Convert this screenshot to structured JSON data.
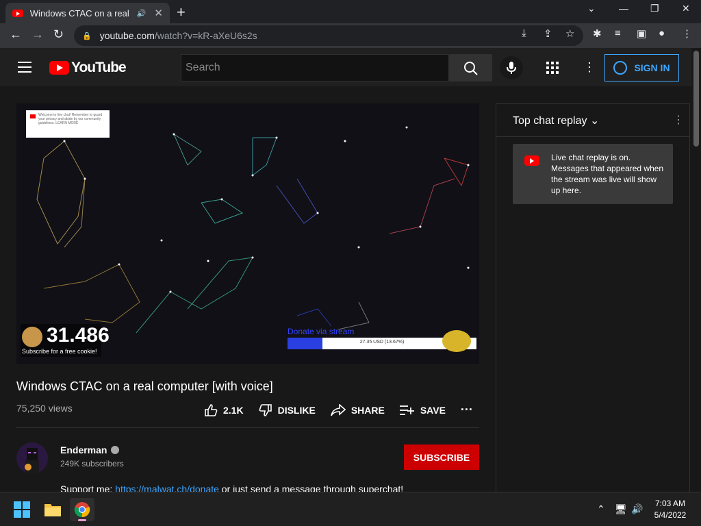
{
  "browser": {
    "tab_title": "Windows CTAC on a real computer [with voice]",
    "url_host": "youtube.com",
    "url_path": "/watch?v=kR-aXeU6s2s"
  },
  "header": {
    "logo_text": "YouTube",
    "search_placeholder": "Search",
    "signin_label": "SIGN IN"
  },
  "video": {
    "overlay_notice": "Welcome to live chat! Remember to guard your privacy and abide by our community guidelines. LEARN MORE",
    "cookie_count": "31.486",
    "cookie_sub": "Subscribe for a free cookie!",
    "donate_label": "Donate via stream",
    "progress_label": "27.35 USD (13.67%)",
    "progress_fraction": 0.1367,
    "title": "Windows CTAC on a real computer [with voice]",
    "views": "75,250 views",
    "like_count": "2.1K",
    "dislike_label": "DISLIKE",
    "share_label": "SHARE",
    "save_label": "SAVE"
  },
  "channel": {
    "name": "Enderman",
    "subscribers": "249K subscribers",
    "subscribe_label": "SUBSCRIBE",
    "desc_prefix": "Support me: ",
    "desc_link": "https://malwat.ch/donate",
    "desc_suffix": " or just send a message through superchat!"
  },
  "chat": {
    "header": "Top chat replay",
    "banner": "Live chat replay is on. Messages that appeared when the stream was live will show up here."
  },
  "taskbar": {
    "time": "7:03 AM",
    "date": "5/4/2022"
  }
}
